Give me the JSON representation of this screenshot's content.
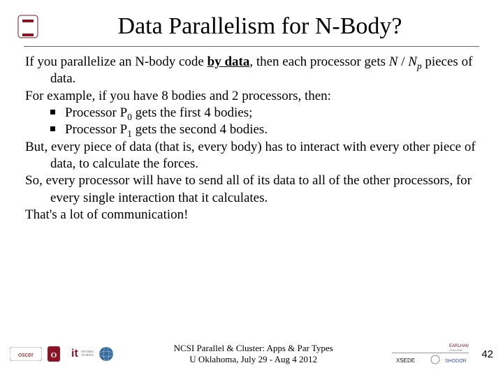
{
  "title": "Data Parallelism for N-Body?",
  "body": {
    "p1_a": "If you parallelize an N-body code ",
    "p1_b": "by data",
    "p1_c": ", then each processor gets ",
    "p1_d": "N",
    "p1_e": " / ",
    "p1_f": "N",
    "p1_g": "p",
    "p1_h": " pieces of data.",
    "p2": "For example, if you have 8 bodies and 2 processors, then:",
    "bul1_a": "Processor P",
    "bul1_b": "0",
    "bul1_c": " gets the first 4 bodies;",
    "bul2_a": "Processor P",
    "bul2_b": "1",
    "bul2_c": " gets the second 4 bodies.",
    "p3": "But, every piece of data (that is, every body) has to interact with every other piece of data, to calculate the forces.",
    "p4": "So, every processor will have to send all of its data to all of the other processors, for every single interaction that it calculates.",
    "p5": "That's a lot of communication!"
  },
  "footer": {
    "line1": "NCSI Parallel & Cluster: Apps & Par Types",
    "line2": "U Oklahoma, July 29 - Aug 4 2012",
    "page": "42"
  },
  "logos": {
    "ou_main": "OU",
    "oscer": "oscer",
    "ou_small": "OU",
    "it": "it",
    "globe": "globe",
    "xsede": "XSEDE",
    "earlham": "EARLHAM",
    "shodor": "SHODOR"
  }
}
